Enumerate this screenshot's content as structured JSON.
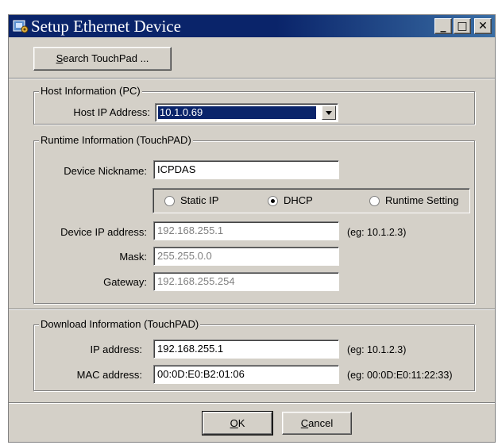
{
  "window": {
    "title": "Setup Ethernet Device",
    "controls": {
      "minimize": "_",
      "maximize": "□",
      "close": "✕"
    }
  },
  "search_button": {
    "mnemonic": "S",
    "label_rest": "earch TouchPad ..."
  },
  "host_group": {
    "legend": "Host Information (PC)",
    "ip_label": "Host IP Address:",
    "ip_selected": "10.1.0.69"
  },
  "runtime_group": {
    "legend": "Runtime Information (TouchPAD)",
    "nickname_label": "Device Nickname:",
    "nickname_value": "ICPDAS",
    "modes": [
      {
        "label": "Static IP",
        "checked": false
      },
      {
        "label": "DHCP",
        "checked": true
      },
      {
        "label": "Runtime Setting",
        "checked": false
      }
    ],
    "device_ip_label": "Device IP address:",
    "device_ip_value": "192.168.255.1",
    "device_ip_hint": "(eg: 10.1.2.3)",
    "mask_label": "Mask:",
    "mask_value": "255.255.0.0",
    "gateway_label": "Gateway:",
    "gateway_value": "192.168.255.254"
  },
  "download_group": {
    "legend": "Download Information (TouchPAD)",
    "ip_label": "IP address:",
    "ip_value": "192.168.255.1",
    "ip_hint": "(eg: 10.1.2.3)",
    "mac_label": "MAC address:",
    "mac_value": "00:0D:E0:B2:01:06",
    "mac_hint": "(eg: 00:0D:E0:11:22:33)"
  },
  "footer": {
    "ok": {
      "mnemonic": "O",
      "label_rest": "K"
    },
    "cancel": {
      "mnemonic": "C",
      "label_rest": "ancel"
    }
  }
}
